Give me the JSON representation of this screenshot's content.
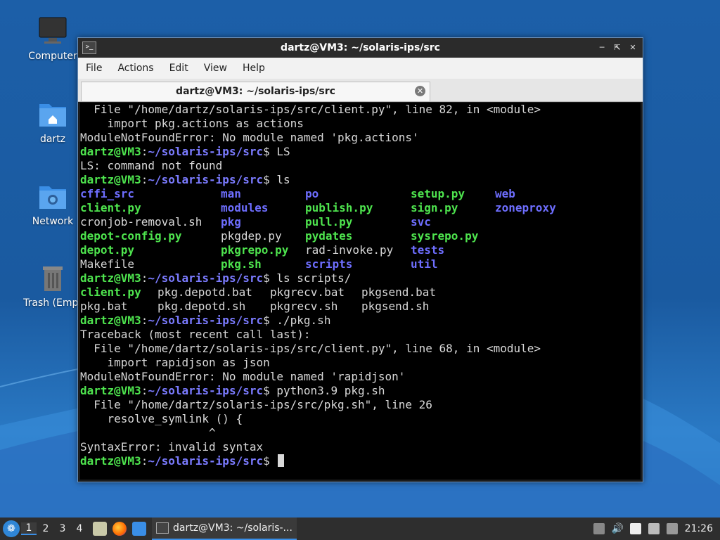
{
  "desktop": {
    "icons": [
      {
        "label": "Computer"
      },
      {
        "label": "dartz"
      },
      {
        "label": "Network"
      },
      {
        "label": "Trash (Empt"
      }
    ]
  },
  "window": {
    "title": "dartz@VM3: ~/solaris-ips/src",
    "menu": [
      "File",
      "Actions",
      "Edit",
      "View",
      "Help"
    ],
    "tab_title": "dartz@VM3: ~/solaris-ips/src",
    "prompt_user": "dartz@VM3",
    "prompt_path": "~/solaris-ips/src",
    "prompt_symbol": "$"
  },
  "terminal": {
    "l1": "  File \"/home/dartz/solaris-ips/src/client.py\", line 82, in <module>",
    "l2": "    import pkg.actions as actions",
    "l3": "ModuleNotFoundError: No module named 'pkg.actions'",
    "cmd1": " LS",
    "l5": "LS: command not found",
    "cmd2": " ls",
    "ls_cols": [
      [
        "cffi_src",
        "client.py",
        "cronjob-removal.sh",
        "depot-config.py",
        "depot.py",
        "Makefile"
      ],
      [
        "man",
        "modules",
        "pkg",
        "pkgdep.py",
        "pkgrepo.py",
        "pkg.sh"
      ],
      [
        "po",
        "publish.py",
        "pull.py",
        "pydates",
        "rad-invoke.py",
        "scripts"
      ],
      [
        "setup.py",
        "sign.py",
        "svc",
        "sysrepo.py",
        "tests",
        "util"
      ],
      [
        "web",
        "zoneproxy"
      ]
    ],
    "cmd3": " ls scripts/",
    "scripts_row1": [
      "client.py",
      "pkg.depotd.bat",
      "pkgrecv.bat",
      "pkgsend.bat"
    ],
    "scripts_row2": [
      "pkg.bat",
      "pkg.depotd.sh",
      "pkgrecv.sh",
      "pkgsend.sh"
    ],
    "cmd4": " ./pkg.sh",
    "t1": "Traceback (most recent call last):",
    "t2": "  File \"/home/dartz/solaris-ips/src/client.py\", line 68, in <module>",
    "t3": "    import rapidjson as json",
    "t4": "ModuleNotFoundError: No module named 'rapidjson'",
    "cmd5": " python3.9 pkg.sh",
    "s1": "  File \"/home/dartz/solaris-ips/src/pkg.sh\", line 26",
    "s2": "    resolve_symlink () {",
    "s3": "                   ^",
    "s4": "SyntaxError: invalid syntax"
  },
  "taskbar": {
    "workspaces": [
      "1",
      "2",
      "3",
      "4"
    ],
    "task_label": "dartz@VM3: ~/solaris-...",
    "clock": "21:26"
  }
}
